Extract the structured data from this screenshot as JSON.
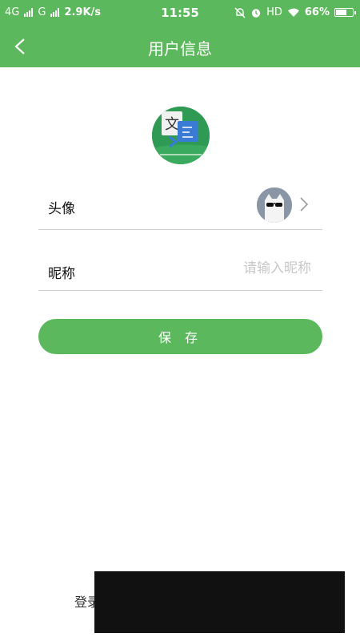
{
  "status_bar": {
    "network1": "4G",
    "network2": "G",
    "speed": "2.9K/s",
    "time": "11:55",
    "hd": "HD",
    "battery_text": "66%",
    "battery_level": 0.66,
    "icons": [
      "signal-icon",
      "mute-bell-icon",
      "alarm-icon",
      "wifi-icon",
      "battery-icon"
    ]
  },
  "header": {
    "title": "用户信息",
    "back_icon": "chevron-left-icon",
    "background_color": "#5cb85c"
  },
  "form": {
    "avatar_label": "头像",
    "nickname_label": "昵称",
    "nickname_placeholder": "请输入昵称",
    "nickname_value": ""
  },
  "save_button": {
    "label": "保 存"
  },
  "footer": {
    "text": "登录"
  }
}
